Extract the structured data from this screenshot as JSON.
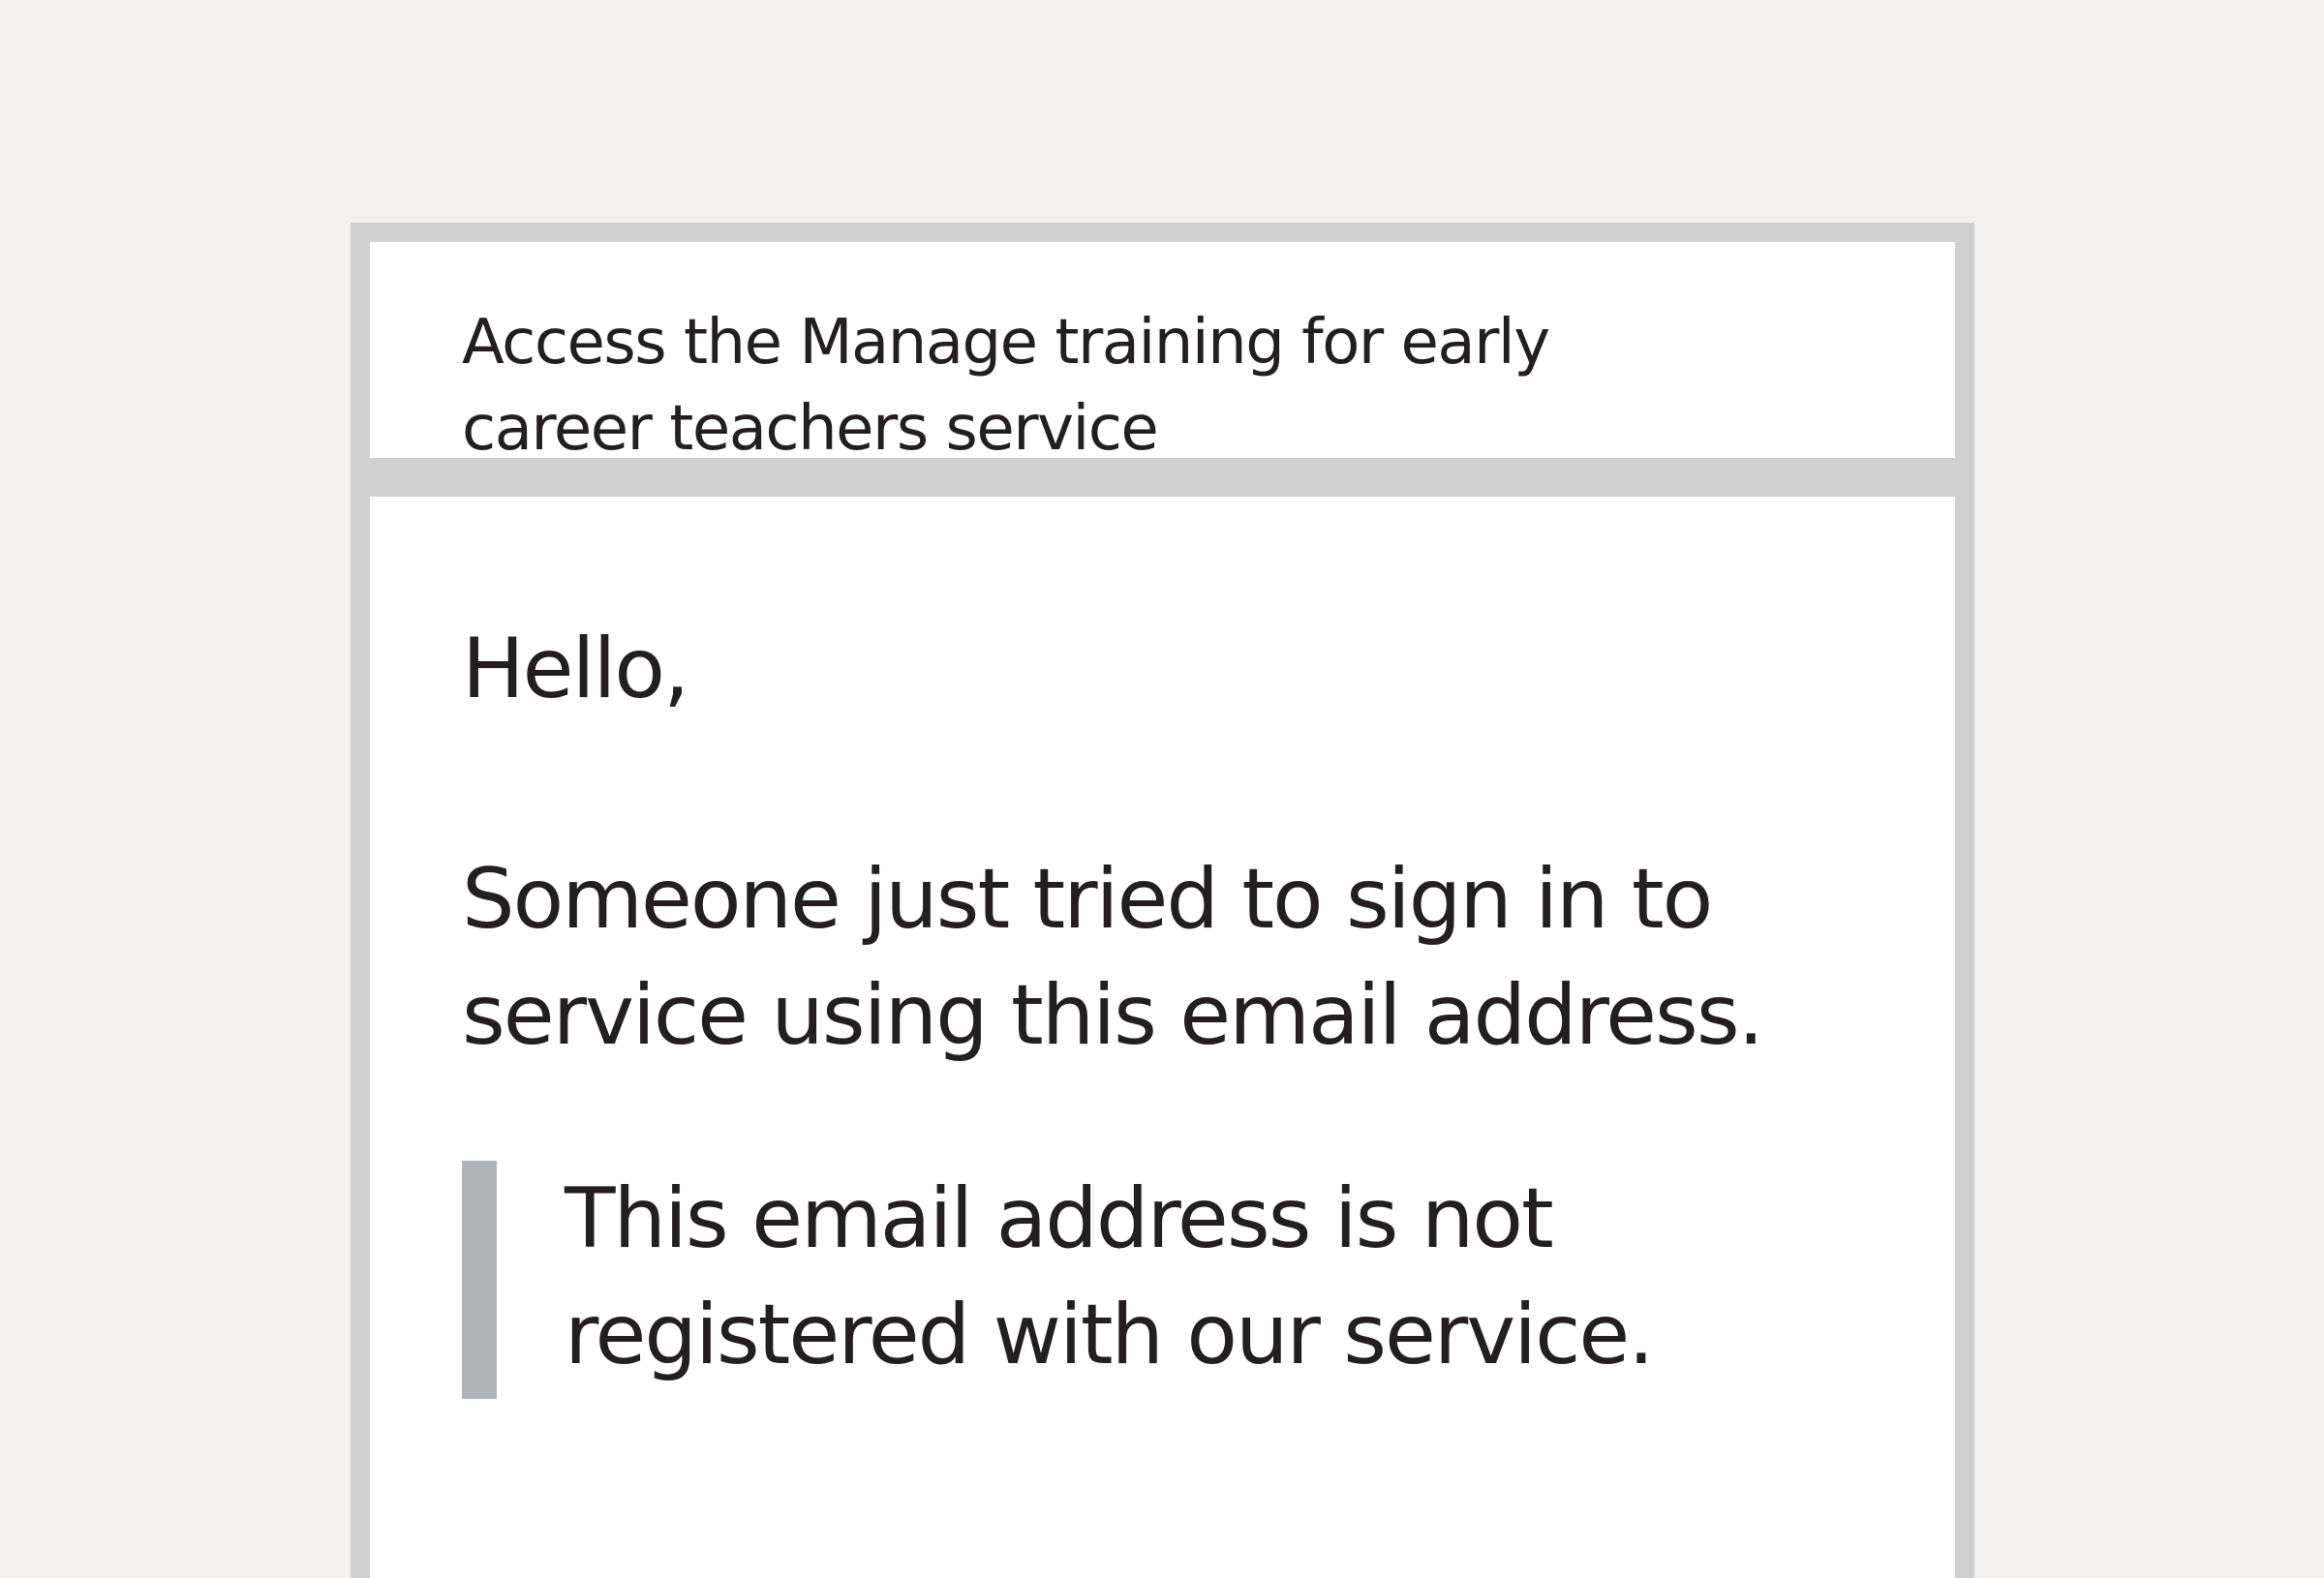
{
  "email": {
    "subject": "Access the Manage training for early career teachers service",
    "greeting": "Hello,",
    "paragraph": "Someone just tried to sign in to service using this email address.",
    "inset": "This email address is not registered with our service."
  },
  "colors": {
    "background": "#f3f2f1",
    "frame": "#d0d0d0",
    "text": "#231f20",
    "inset_border": "#b1b4b6"
  }
}
